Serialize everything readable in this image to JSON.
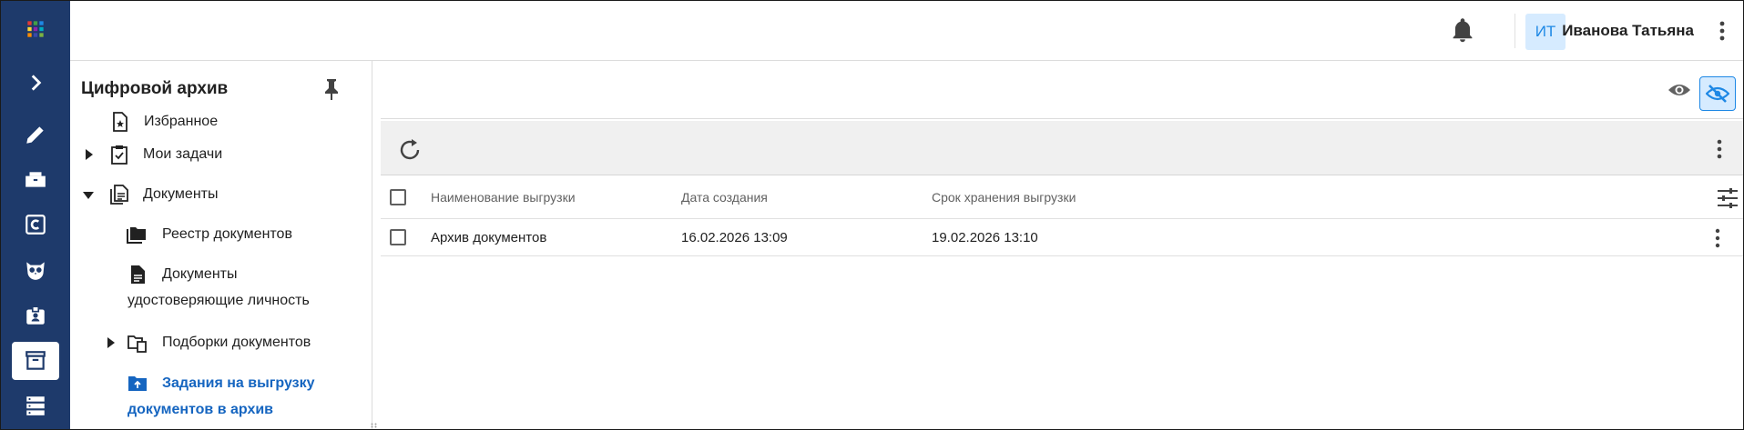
{
  "header": {
    "user_initials": "ИТ",
    "user_name": "Иванова Татьяна"
  },
  "rail": {
    "items": [
      {
        "icon": "grid-apps-icon"
      },
      {
        "icon": "chevron-right-icon"
      },
      {
        "icon": "pencil-icon"
      },
      {
        "icon": "inbox-tray-icon"
      },
      {
        "icon": "c-square-icon"
      },
      {
        "icon": "owl-icon"
      },
      {
        "icon": "badge-user-icon"
      },
      {
        "icon": "archive-box-icon",
        "active": true
      },
      {
        "icon": "server-stack-icon"
      }
    ]
  },
  "sidebar": {
    "title": "Цифровой архив",
    "items": [
      {
        "label": "Избранное",
        "icon": "star-document-icon"
      },
      {
        "label": "Мои задачи",
        "icon": "clipboard-icon",
        "expander": "collapsed"
      },
      {
        "label": "Документы",
        "icon": "documents-icon",
        "expander": "expanded"
      },
      {
        "label": "Реестр документов",
        "icon": "folders-icon"
      },
      {
        "label_line1": "Документы",
        "label_line2": "удостоверяющие личность",
        "icon": "document-icon"
      },
      {
        "label": "Подборки документов",
        "icon": "folder-copy-icon",
        "expander": "collapsed"
      },
      {
        "label_line1": "Задания на выгрузку",
        "label_line2": "документов в архив",
        "icon": "folder-upload-icon",
        "active": true
      }
    ]
  },
  "table": {
    "columns": [
      "Наименование выгрузки",
      "Дата создания",
      "Срок хранения выгрузки"
    ],
    "rows": [
      {
        "name": "Архив документов",
        "created": "16.02.2026 13:09",
        "retention": "19.02.2026 13:10"
      }
    ]
  },
  "colors": {
    "rail": "#1e3a6b",
    "accent": "#1e88e5",
    "active_text": "#1565c0"
  }
}
